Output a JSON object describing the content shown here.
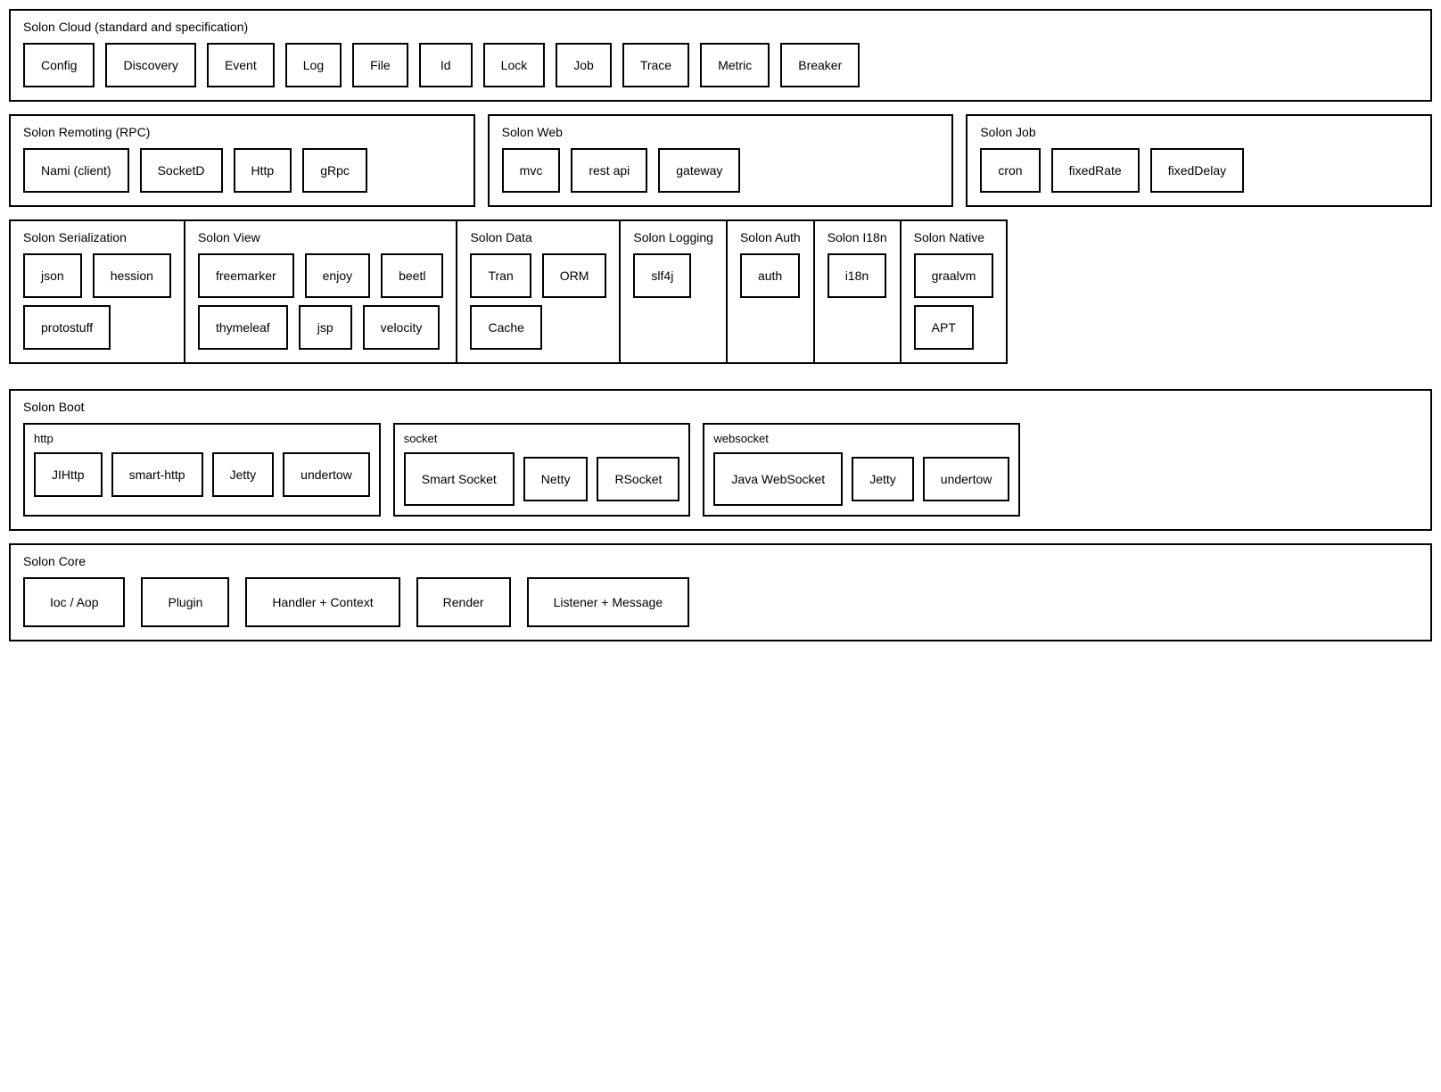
{
  "cloud": {
    "title": "Solon Cloud (standard and specification)",
    "items": [
      "Config",
      "Discovery",
      "Event",
      "Log",
      "File",
      "Id",
      "Lock",
      "Job",
      "Trace",
      "Metric",
      "Breaker"
    ]
  },
  "remoting": {
    "title": "Solon Remoting (RPC)",
    "items": [
      "Nami (client)",
      "SocketD",
      "Http",
      "gRpc"
    ]
  },
  "web": {
    "title": "Solon Web",
    "items": [
      "mvc",
      "rest api",
      "gateway"
    ]
  },
  "job": {
    "title": "Solon Job",
    "items": [
      "cron",
      "fixedRate",
      "fixedDelay"
    ]
  },
  "serialization": {
    "title": "Solon Serialization",
    "row1": [
      "json",
      "hession"
    ],
    "row2": [
      "protostuff"
    ]
  },
  "view": {
    "title": "Solon View",
    "row1": [
      "freemarker",
      "enjoy",
      "beetl"
    ],
    "row2": [
      "thymeleaf",
      "jsp",
      "velocity"
    ]
  },
  "data": {
    "title": "Solon Data",
    "row1": [
      "Tran",
      "ORM"
    ],
    "row2": [
      "Cache"
    ]
  },
  "logging": {
    "title": "Solon Logging",
    "items": [
      "slf4j"
    ]
  },
  "auth": {
    "title": "Solon Auth",
    "items": [
      "auth"
    ]
  },
  "i18n": {
    "title": "Solon I18n",
    "items": [
      "i18n"
    ]
  },
  "native": {
    "title": "Solon Native",
    "row1": [
      "graalvm"
    ],
    "row2": [
      "APT"
    ]
  },
  "boot": {
    "title": "Solon Boot",
    "http": {
      "title": "http",
      "items": [
        "JIHttp",
        "smart-http",
        "Jetty",
        "undertow"
      ]
    },
    "socket": {
      "title": "socket",
      "items": [
        "Smart Socket",
        "Netty",
        "RSocket"
      ]
    },
    "websocket": {
      "title": "websocket",
      "items": [
        "Java WebSocket",
        "Jetty",
        "undertow"
      ]
    }
  },
  "core": {
    "title": "Solon Core",
    "items": [
      "Ioc / Aop",
      "Plugin",
      "Handler + Context",
      "Render",
      "Listener + Message"
    ]
  }
}
